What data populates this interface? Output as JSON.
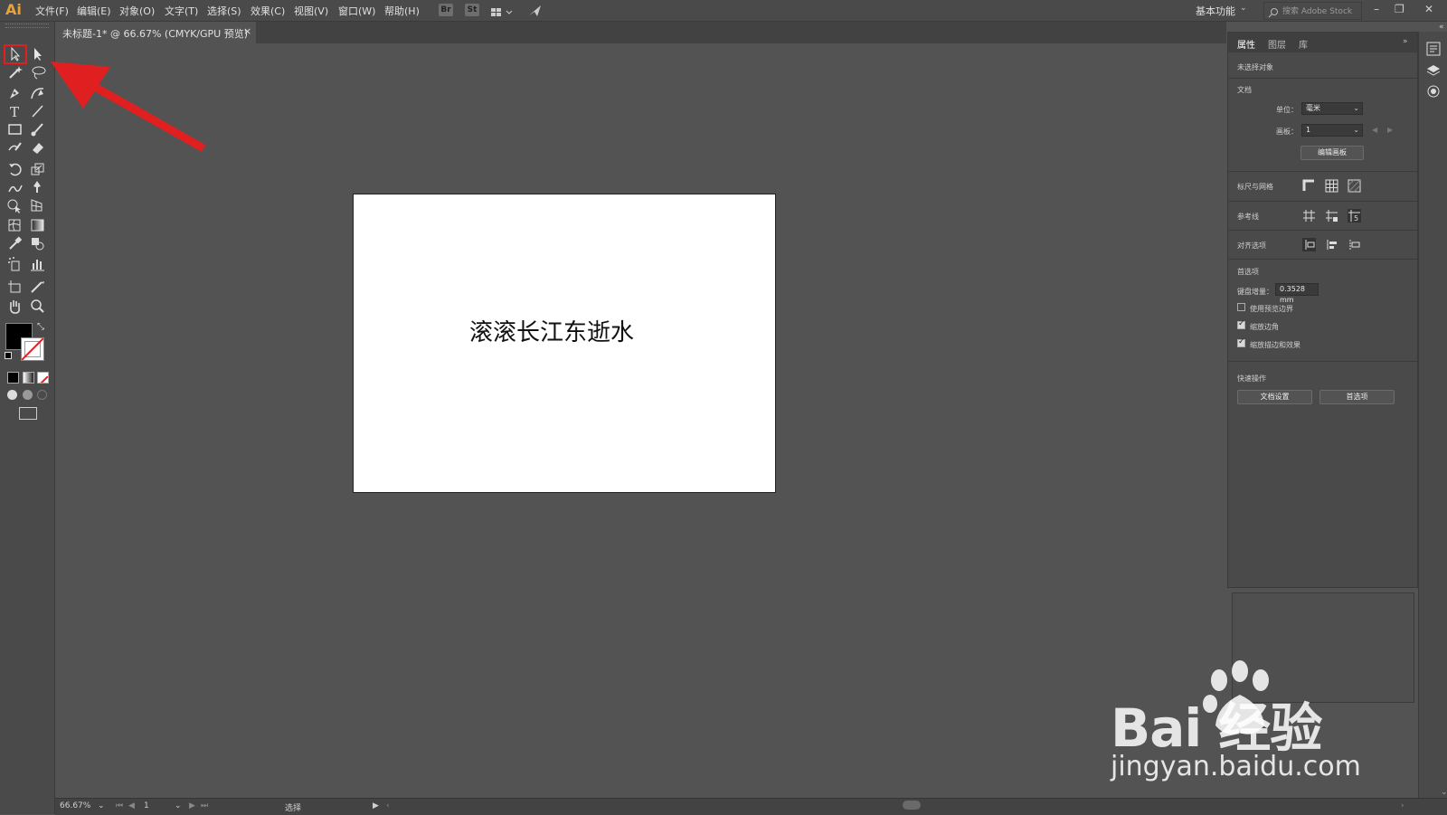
{
  "app": {
    "logo": "Ai"
  },
  "menubar": {
    "items": [
      "文件(F)",
      "编辑(E)",
      "对象(O)",
      "文字(T)",
      "选择(S)",
      "效果(C)",
      "视图(V)",
      "窗口(W)",
      "帮助(H)"
    ],
    "bridge_label": "Br",
    "stock_label": "St",
    "workspace": "基本功能",
    "search_placeholder": "搜索 Adobe Stock"
  },
  "document": {
    "tab_label": "未标题-1* @ 66.67% (CMYK/GPU 预览)",
    "close": "×",
    "artboard_text": "滚滚长江东逝水"
  },
  "panel": {
    "tabs": [
      "属性",
      "图层",
      "库"
    ],
    "no_selection": "未选择对象",
    "doc_section": "文档",
    "units_label": "单位：",
    "units_value": "毫米",
    "artboard_label": "画板：",
    "artboard_value": "1",
    "edit_artboards": "编辑画板",
    "rulers_grids": "标尺与网格",
    "guides": "参考线",
    "align_options": "对齐选项",
    "preferences": "首选项",
    "keyboard_increment_label": "键盘增量：",
    "keyboard_increment_value": "0.3528 mm",
    "cb_preview_bounds": "使用预览边界",
    "cb_scale_corners": "缩放边角",
    "cb_scale_strokes": "缩放描边和效果",
    "preview_bounds_checked": false,
    "scale_corners_checked": true,
    "scale_strokes_checked": true,
    "quick_actions": "快速操作",
    "doc_setup_button": "文档设置",
    "prefs_button": "首选项"
  },
  "statusbar": {
    "zoom": "66.67%",
    "artboard_num": "1",
    "tool_name": "选择"
  },
  "watermark": {
    "logo": "Bai  经验",
    "url": "jingyan.baidu.com"
  },
  "colors": {
    "accent_red": "#e02020",
    "bg": "#535353",
    "panel": "#4a4a4a"
  }
}
